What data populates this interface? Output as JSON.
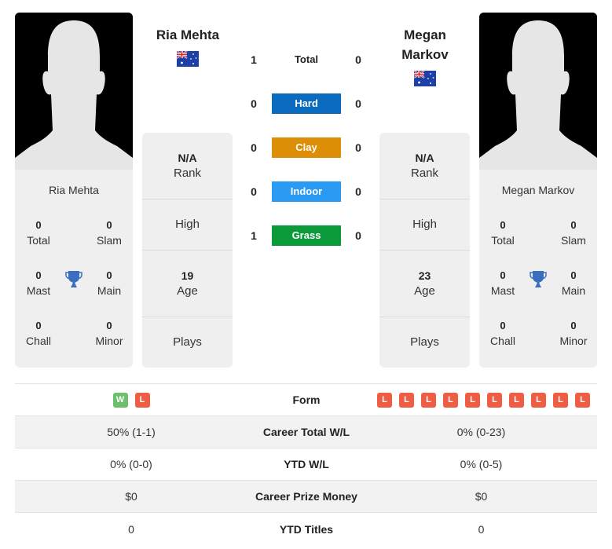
{
  "players": [
    {
      "name": "Ria Mehta",
      "card_name": "Ria Mehta",
      "flag": "australia-flag",
      "titles": {
        "total": {
          "value": "0",
          "label": "Total"
        },
        "slam": {
          "value": "0",
          "label": "Slam"
        },
        "mast": {
          "value": "0",
          "label": "Mast"
        },
        "main": {
          "value": "0",
          "label": "Main"
        },
        "chall": {
          "value": "0",
          "label": "Chall"
        },
        "minor": {
          "value": "0",
          "label": "Minor"
        }
      },
      "info": {
        "rank": {
          "value": "N/A",
          "label": "Rank"
        },
        "high": {
          "value": "",
          "label": "High"
        },
        "age": {
          "value": "19",
          "label": "Age"
        },
        "plays": {
          "value": "",
          "label": "Plays"
        }
      }
    },
    {
      "name": "Megan Markov",
      "name_line1": "Megan",
      "name_line2": "Markov",
      "card_name": "Megan Markov",
      "flag": "australia-flag",
      "titles": {
        "total": {
          "value": "0",
          "label": "Total"
        },
        "slam": {
          "value": "0",
          "label": "Slam"
        },
        "mast": {
          "value": "0",
          "label": "Mast"
        },
        "main": {
          "value": "0",
          "label": "Main"
        },
        "chall": {
          "value": "0",
          "label": "Chall"
        },
        "minor": {
          "value": "0",
          "label": "Minor"
        }
      },
      "info": {
        "rank": {
          "value": "N/A",
          "label": "Rank"
        },
        "high": {
          "value": "",
          "label": "High"
        },
        "age": {
          "value": "23",
          "label": "Age"
        },
        "plays": {
          "value": "",
          "label": "Plays"
        }
      }
    }
  ],
  "h2h": [
    {
      "label": "Total",
      "left": "1",
      "right": "0",
      "color": ""
    },
    {
      "label": "Hard",
      "left": "0",
      "right": "0",
      "color": "#0a6bbf"
    },
    {
      "label": "Clay",
      "left": "0",
      "right": "0",
      "color": "#dd8e07"
    },
    {
      "label": "Indoor",
      "left": "0",
      "right": "0",
      "color": "#2b9af3"
    },
    {
      "label": "Grass",
      "left": "1",
      "right": "0",
      "color": "#0a9a3a"
    }
  ],
  "stats": {
    "form": {
      "label": "Form",
      "left": [
        "W",
        "L"
      ],
      "right": [
        "L",
        "L",
        "L",
        "L",
        "L",
        "L",
        "L",
        "L",
        "L",
        "L"
      ]
    },
    "rows": [
      {
        "label": "Career Total W/L",
        "left": "50% (1-1)",
        "right": "0% (0-23)"
      },
      {
        "label": "YTD W/L",
        "left": "0% (0-0)",
        "right": "0% (0-5)"
      },
      {
        "label": "Career Prize Money",
        "left": "$0",
        "right": "$0"
      },
      {
        "label": "YTD Titles",
        "left": "0",
        "right": "0"
      }
    ]
  },
  "colors": {
    "win": "#6cbf6c",
    "loss": "#ef5d44",
    "trophy": "#3a6fbf"
  }
}
